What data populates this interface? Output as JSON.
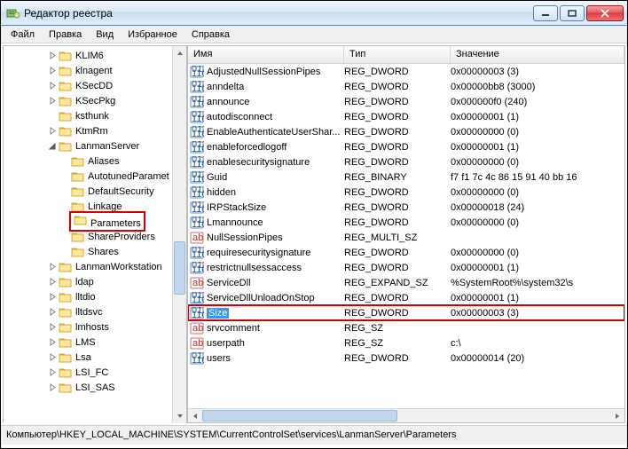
{
  "window": {
    "title": "Редактор реестра"
  },
  "menu": {
    "file": "Файл",
    "edit": "Правка",
    "view": "Вид",
    "favorites": "Избранное",
    "help": "Справка"
  },
  "columns": {
    "name": "Имя",
    "type": "Тип",
    "data": "Значение"
  },
  "tree": [
    {
      "indent": 3,
      "exp": "closed",
      "label": "KLIM6"
    },
    {
      "indent": 3,
      "exp": "closed",
      "label": "klnagent"
    },
    {
      "indent": 3,
      "exp": "closed",
      "label": "KSecDD"
    },
    {
      "indent": 3,
      "exp": "closed",
      "label": "KSecPkg"
    },
    {
      "indent": 3,
      "exp": "none",
      "label": "ksthunk"
    },
    {
      "indent": 3,
      "exp": "closed",
      "label": "KtmRm"
    },
    {
      "indent": 3,
      "exp": "open",
      "label": "LanmanServer"
    },
    {
      "indent": 4,
      "exp": "none",
      "label": "Aliases"
    },
    {
      "indent": 4,
      "exp": "none",
      "label": "AutotunedParamet"
    },
    {
      "indent": 4,
      "exp": "none",
      "label": "DefaultSecurity"
    },
    {
      "indent": 4,
      "exp": "none",
      "label": "Linkage"
    },
    {
      "indent": 4,
      "exp": "none",
      "label": "Parameters",
      "highlight": true
    },
    {
      "indent": 4,
      "exp": "none",
      "label": "ShareProviders"
    },
    {
      "indent": 4,
      "exp": "none",
      "label": "Shares"
    },
    {
      "indent": 3,
      "exp": "closed",
      "label": "LanmanWorkstation"
    },
    {
      "indent": 3,
      "exp": "closed",
      "label": "ldap"
    },
    {
      "indent": 3,
      "exp": "closed",
      "label": "lltdio"
    },
    {
      "indent": 3,
      "exp": "closed",
      "label": "lltdsvc"
    },
    {
      "indent": 3,
      "exp": "closed",
      "label": "lmhosts"
    },
    {
      "indent": 3,
      "exp": "closed",
      "label": "LMS"
    },
    {
      "indent": 3,
      "exp": "closed",
      "label": "Lsa"
    },
    {
      "indent": 3,
      "exp": "closed",
      "label": "LSI_FC"
    },
    {
      "indent": 3,
      "exp": "closed",
      "label": "LSI_SAS"
    }
  ],
  "values": [
    {
      "kind": "bin",
      "name": "AdjustedNullSessionPipes",
      "type": "REG_DWORD",
      "data": "0x00000003 (3)"
    },
    {
      "kind": "bin",
      "name": "anndelta",
      "type": "REG_DWORD",
      "data": "0x00000bb8 (3000)"
    },
    {
      "kind": "bin",
      "name": "announce",
      "type": "REG_DWORD",
      "data": "0x000000f0 (240)"
    },
    {
      "kind": "bin",
      "name": "autodisconnect",
      "type": "REG_DWORD",
      "data": "0x00000001 (1)"
    },
    {
      "kind": "bin",
      "name": "EnableAuthenticateUserShar...",
      "type": "REG_DWORD",
      "data": "0x00000000 (0)"
    },
    {
      "kind": "bin",
      "name": "enableforcedlogoff",
      "type": "REG_DWORD",
      "data": "0x00000001 (1)"
    },
    {
      "kind": "bin",
      "name": "enablesecuritysignature",
      "type": "REG_DWORD",
      "data": "0x00000000 (0)"
    },
    {
      "kind": "bin",
      "name": "Guid",
      "type": "REG_BINARY",
      "data": "f7 f1 7c 4c 86 15 91 40 bb 16"
    },
    {
      "kind": "bin",
      "name": "hidden",
      "type": "REG_DWORD",
      "data": "0x00000000 (0)"
    },
    {
      "kind": "bin",
      "name": "IRPStackSize",
      "type": "REG_DWORD",
      "data": "0x00000018 (24)"
    },
    {
      "kind": "bin",
      "name": "Lmannounce",
      "type": "REG_DWORD",
      "data": "0x00000000 (0)"
    },
    {
      "kind": "str",
      "name": "NullSessionPipes",
      "type": "REG_MULTI_SZ",
      "data": ""
    },
    {
      "kind": "bin",
      "name": "requiresecuritysignature",
      "type": "REG_DWORD",
      "data": "0x00000000 (0)"
    },
    {
      "kind": "bin",
      "name": "restrictnullsessaccess",
      "type": "REG_DWORD",
      "data": "0x00000001 (1)"
    },
    {
      "kind": "str",
      "name": "ServiceDll",
      "type": "REG_EXPAND_SZ",
      "data": "%SystemRoot%\\system32\\s"
    },
    {
      "kind": "bin",
      "name": "ServiceDllUnloadOnStop",
      "type": "REG_DWORD",
      "data": "0x00000001 (1)"
    },
    {
      "kind": "bin",
      "name": "Size",
      "type": "REG_DWORD",
      "data": "0x00000003 (3)",
      "selected": true,
      "redbox": true
    },
    {
      "kind": "str",
      "name": "srvcomment",
      "type": "REG_SZ",
      "data": ""
    },
    {
      "kind": "str",
      "name": "userpath",
      "type": "REG_SZ",
      "data": "c:\\"
    },
    {
      "kind": "bin",
      "name": "users",
      "type": "REG_DWORD",
      "data": "0x00000014 (20)"
    }
  ],
  "status": "Компьютер\\HKEY_LOCAL_MACHINE\\SYSTEM\\CurrentControlSet\\services\\LanmanServer\\Parameters"
}
